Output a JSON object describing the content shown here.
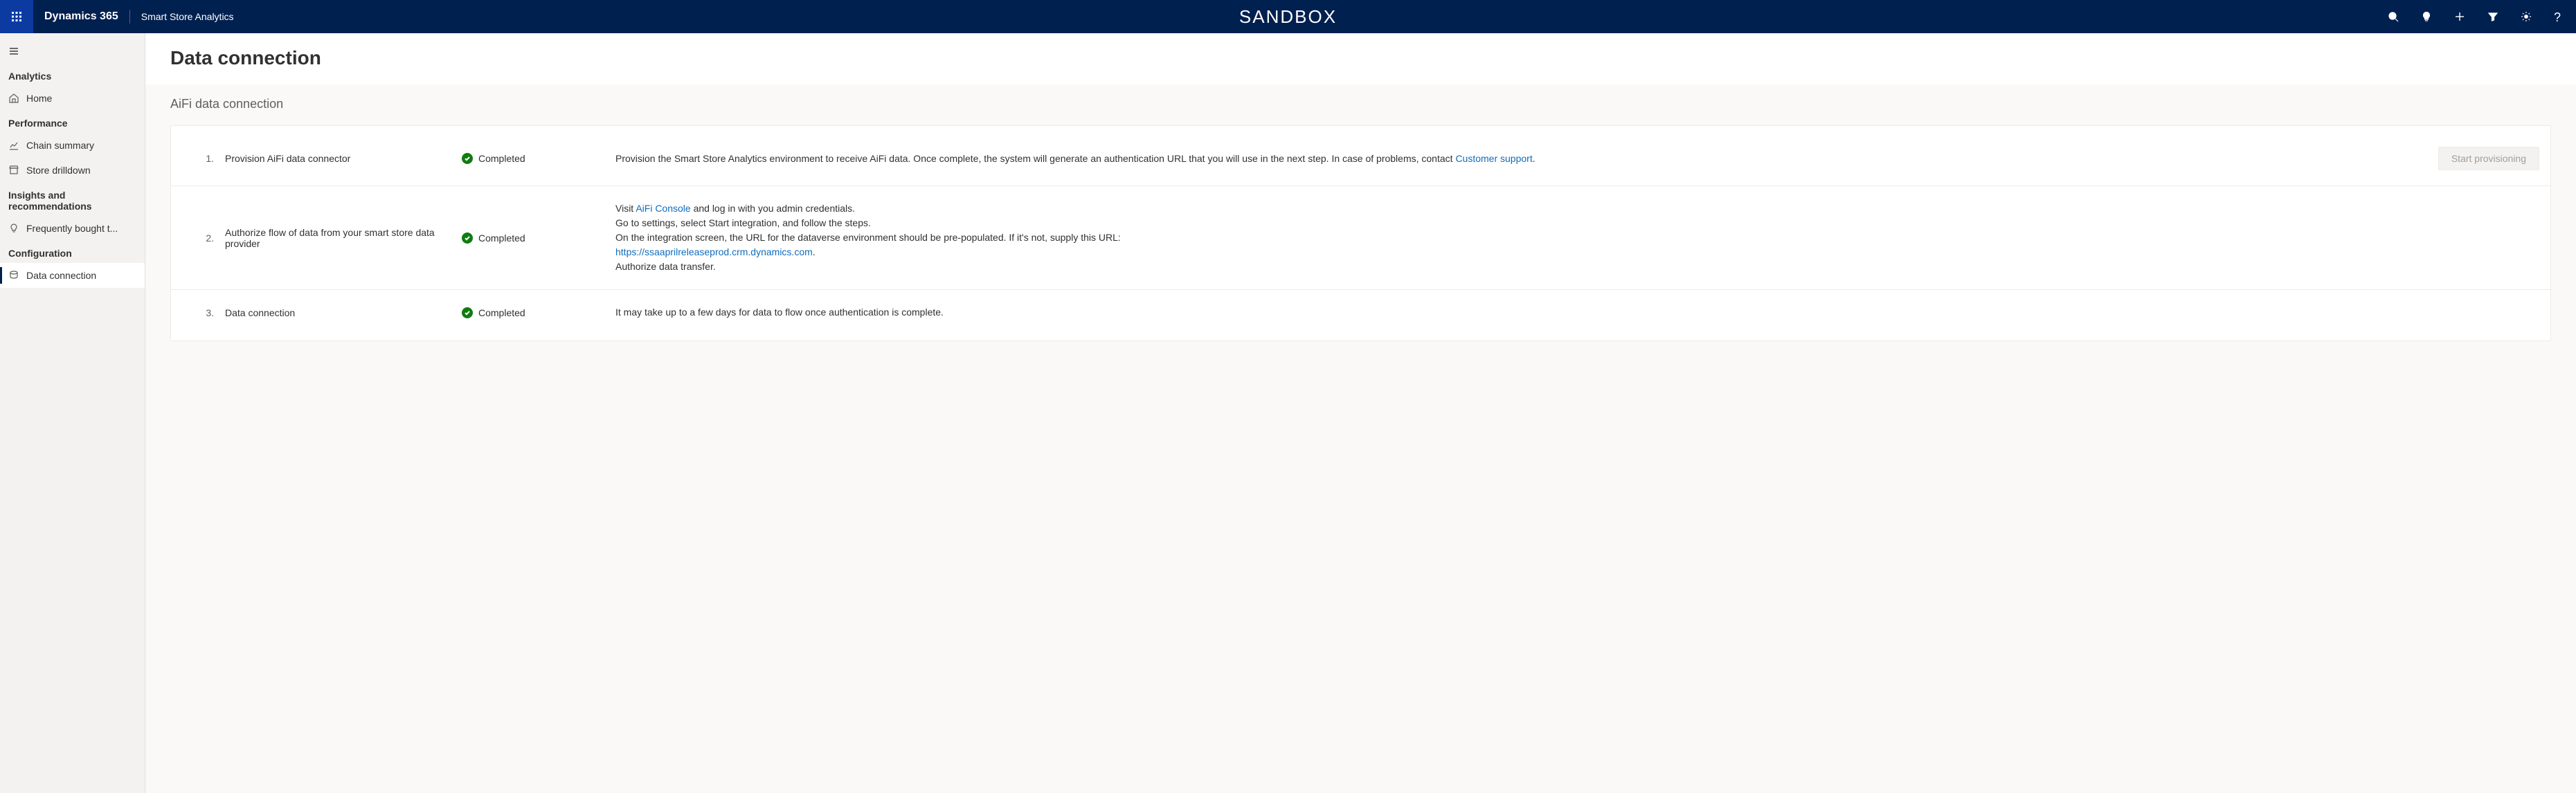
{
  "header": {
    "brand": "Dynamics 365",
    "app_name": "Smart Store Analytics",
    "env_label": "SANDBOX"
  },
  "sidebar": {
    "groups": [
      {
        "label": "Analytics",
        "items": [
          {
            "label": "Home"
          }
        ]
      },
      {
        "label": "Performance",
        "items": [
          {
            "label": "Chain summary"
          },
          {
            "label": "Store drilldown"
          }
        ]
      },
      {
        "label": "Insights and recommendations",
        "items": [
          {
            "label": "Frequently bought t..."
          }
        ]
      },
      {
        "label": "Configuration",
        "items": [
          {
            "label": "Data connection"
          }
        ]
      }
    ]
  },
  "page": {
    "title": "Data connection",
    "section_title": "AiFi data connection"
  },
  "status_label": "Completed",
  "steps": [
    {
      "num": "1.",
      "title": "Provision AiFi data connector",
      "desc_pre": "Provision the Smart Store Analytics environment to receive AiFi data. Once complete, the system will generate an authentication URL that you will use in the next step. In case of problems, contact ",
      "link": "Customer support",
      "desc_post": ".",
      "action_label": "Start provisioning"
    },
    {
      "num": "2.",
      "title": "Authorize flow of data from your smart store data provider",
      "line1_pre": "Visit ",
      "line1_link": "AiFi Console",
      "line1_post": " and log in with you admin credentials.",
      "line2": "Go to settings, select Start integration, and follow the steps.",
      "line3": "On the integration screen, the URL for the dataverse environment should be pre-populated. If it's not, supply this URL:",
      "line4_link": "https://ssaaprilreleaseprod.crm.dynamics.com",
      "line4_post": ".",
      "line5": "Authorize data transfer."
    },
    {
      "num": "3.",
      "title": "Data connection",
      "desc": "It may take up to a few days for data to flow once authentication is complete."
    }
  ]
}
